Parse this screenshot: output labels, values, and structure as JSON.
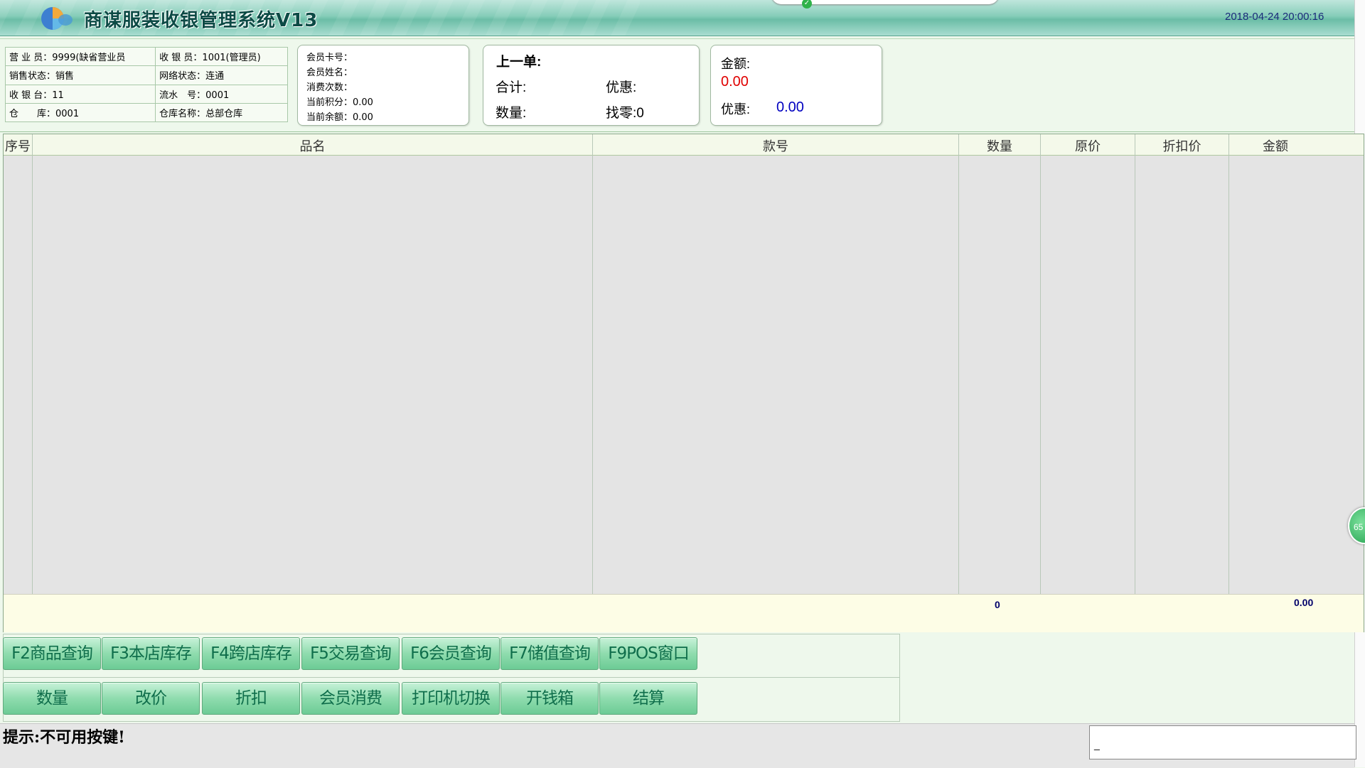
{
  "app": {
    "title": "商谋服装收银管理系统V13",
    "datetime": "2018-04-24 20:00:16"
  },
  "staff_info": {
    "rows": [
      [
        "营 业 员：9999(缺省营业员",
        "收 银 员：1001(管理员)"
      ],
      [
        "销售状态：销售",
        "网络状态：连通"
      ],
      [
        "收 银 台：11",
        "流水　号：0001"
      ],
      [
        "仓　　库：0001",
        "仓库名称：总部仓库"
      ]
    ]
  },
  "member_info": {
    "card_no": "会员卡号：",
    "name": "会员姓名：",
    "visits": "消费次数：",
    "points": "当前积分：0.00",
    "balance": "当前余额：0.00"
  },
  "last_order": {
    "title": "上一单:",
    "total_label": "合计:",
    "discount_label": "优惠:",
    "qty_label": "数量:",
    "change": "找零:0"
  },
  "amount": {
    "amount_label": "金额:",
    "amount_value": "0.00",
    "discount_label": "优惠:",
    "discount_value": "0.00"
  },
  "table": {
    "columns": [
      "序号",
      "品名",
      "款号",
      "数量",
      "原价",
      "折扣价",
      "金额"
    ],
    "rows": [],
    "footer_qty": "0",
    "footer_amount": "0.00"
  },
  "function_buttons": [
    "F2商品查询",
    "F3本店库存",
    "F4跨店库存",
    "F5交易查询",
    "F6会员查询",
    "F7储值查询",
    "F9POS窗口"
  ],
  "action_buttons": [
    "数量",
    "改价",
    "折扣",
    "会员消费",
    "打印机切换",
    "开钱箱",
    "结算"
  ],
  "status": {
    "hint": "提示:不可用按键!",
    "input_value": "_"
  },
  "float_ball_text": "65",
  "colors": {
    "title_bar": "#86cdb9",
    "button_text": "#0f6e4b",
    "amount_red": "#e00000",
    "discount_blue": "#0000c0",
    "footer_bg": "#fdfde6"
  }
}
